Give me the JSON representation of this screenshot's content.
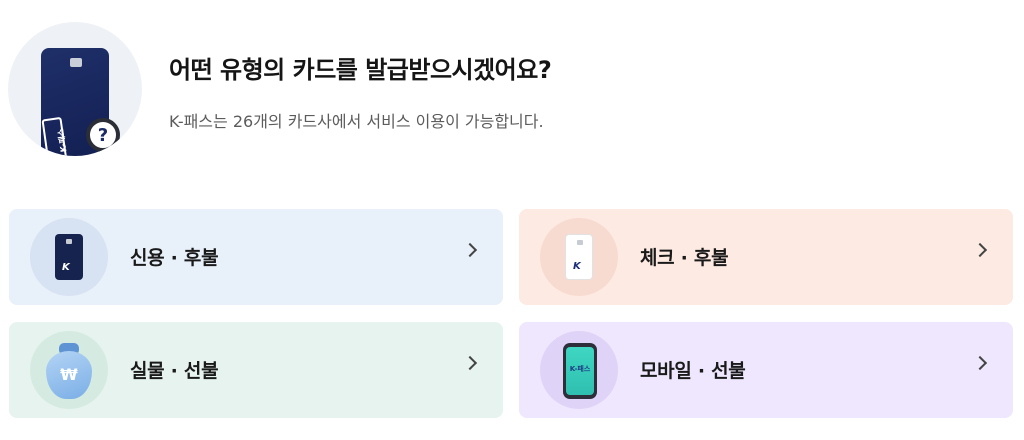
{
  "header": {
    "title": "어떤 유형의 카드를 발급받으시겠어요?",
    "subtitle": "K-패스는 26개의 카드사에서 서비스 이용이 가능합니다.",
    "illustration_card_text": "K-패스",
    "illustration_mark": "?"
  },
  "options": [
    {
      "label": "신용 · 후불",
      "icon": "dark-card-icon",
      "logo": "K"
    },
    {
      "label": "체크 · 후불",
      "icon": "white-card-icon",
      "logo": "K"
    },
    {
      "label": "실물 · 선불",
      "icon": "money-bag-icon",
      "symbol": "₩"
    },
    {
      "label": "모바일 · 선불",
      "icon": "phone-icon",
      "screen_text": "K-패스"
    }
  ],
  "colors": {
    "credit_bg": "#e8f0fa",
    "check_bg": "#fdeae2",
    "cash_bg": "#e6f3ee",
    "mobile_bg": "#efe7fd",
    "card_navy": "#17234f"
  }
}
